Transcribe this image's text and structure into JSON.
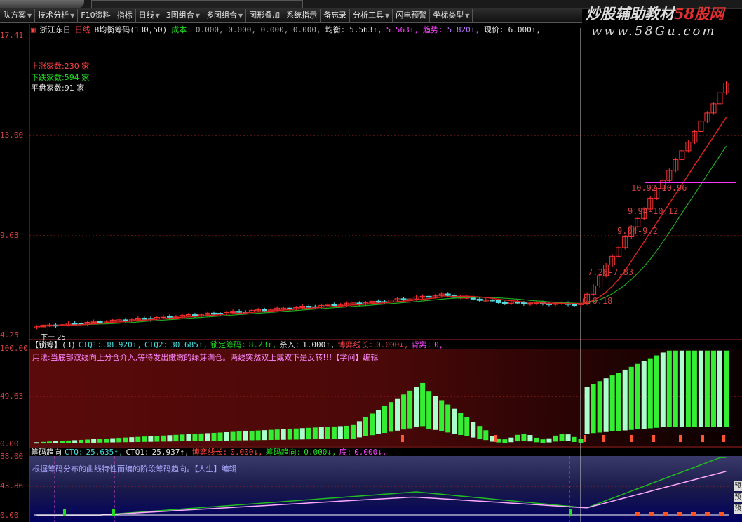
{
  "menu": [
    {
      "label": "队方案",
      "caret": true
    },
    {
      "label": "技术分析",
      "caret": true
    },
    {
      "label": "F10资料",
      "caret": false
    },
    {
      "label": "指标",
      "caret": false
    },
    {
      "label": "日线",
      "caret": true
    },
    {
      "label": "3图组合",
      "caret": true
    },
    {
      "label": "多图组合",
      "caret": true
    },
    {
      "label": "图形叠加",
      "caret": false
    },
    {
      "label": "系统指示",
      "caret": false
    },
    {
      "label": "备忘录",
      "caret": false
    },
    {
      "label": "分析工具",
      "caret": true
    },
    {
      "label": "闪电预警",
      "caret": false
    },
    {
      "label": "坐标类型",
      "caret": true
    }
  ],
  "watermark": {
    "title_a": "炒股辅助教材",
    "title_b": "58股网",
    "url": "www.58Gu.com"
  },
  "main": {
    "stock_name": "浙江东日",
    "period": "日线",
    "indicator": "B均衡筹码(130,50)",
    "cost_label": "成本:",
    "cost_value": "0.000, 0.000, 0.000, 0.000,",
    "balance_label": "均衡:",
    "balance_value": "5.563↑,",
    "balance_value2": "5.563↑,",
    "trend_label": "趋势:",
    "trend_value": "5.820↑,",
    "price_label": "现价:",
    "price_value": "6.000↑,",
    "rise_label": "上涨家数:",
    "rise_value": "230 家",
    "fall_label": "下跌家数:",
    "fall_value": "594 家",
    "flat_label": "平盘家数:",
    "flat_value": "91 家",
    "y_labels": [
      "17.41",
      "13.00",
      "9.63",
      "4.25"
    ],
    "bottom_label": "下一  25",
    "zones": [
      "10.92-10.96",
      "9.94-10.12",
      "9.04-9.2",
      "7.26-7.83",
      "6-6.18"
    ]
  },
  "pane2": {
    "name": "【锁筹】(3)",
    "ctq1_label": "CTQ1:",
    "ctq1": "38.920↑,",
    "ctq2_label": "CTQ2:",
    "ctq2": "30.685↑,",
    "lock_label": "锁定筹码:",
    "lock": "8.23↑,",
    "kill_label": "杀入:",
    "kill": "1.000↑,",
    "game_label": "博弈线长:",
    "game": "0.000↓,",
    "back_label": "背离:",
    "back": "0,",
    "note": "用法:当底部双线向上分仓介入,等待发出嫩嫩的绿芽满仓。两线突然双上或双下是反转!!!【学问】编辑",
    "y_labels": [
      "100.00",
      "49.63",
      "0.00"
    ]
  },
  "pane3": {
    "name": "筹码趋向",
    "ctq_label": "CTQ:",
    "ctq": "25.635↑,",
    "ctq1_label": "CTQ1:",
    "ctq1": "25.937↑,",
    "game_label": "博弈线长:",
    "game": "0.000↓,",
    "trend_label": "筹码趋向:",
    "trend": "0.000↓,",
    "bottom_label": "底:",
    "bottom": "0.000↓,",
    "note": "根据筹码分布的曲线特性而编的阶段筹码趋向。【人生】编辑",
    "y_labels": [
      "88.00",
      "43.86",
      "0.00"
    ]
  },
  "right_tabs": [
    "预",
    "预",
    "预"
  ],
  "colors": {
    "up": "#ff3333",
    "down": "#55dddd",
    "ma1": "#dd2020",
    "ma2": "#22aa22",
    "magenta": "#ff33ff"
  }
}
